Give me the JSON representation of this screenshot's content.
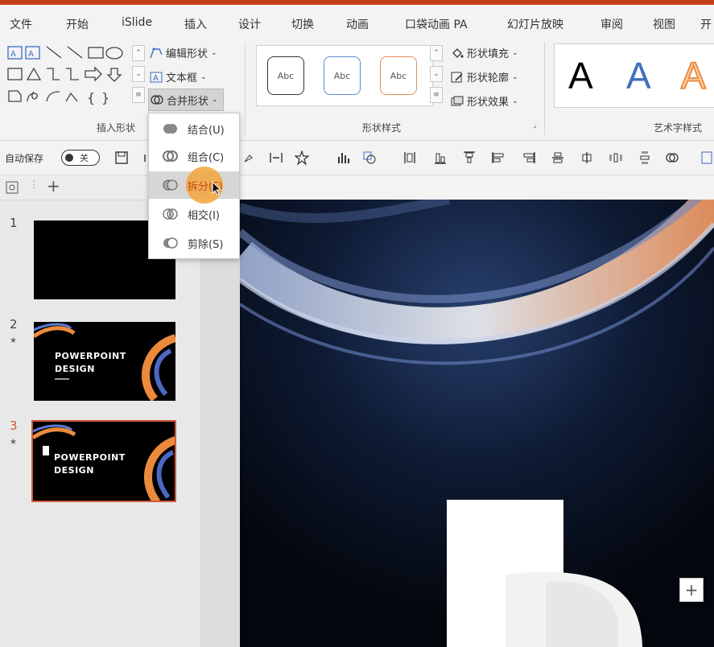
{
  "menu": {
    "tabs": [
      "文件",
      "开始",
      "iSlide",
      "插入",
      "设计",
      "切换",
      "动画",
      "口袋动画 PA",
      "幻灯片放映",
      "审阅",
      "视图",
      "开"
    ]
  },
  "ribbon": {
    "insert_shapes": {
      "label": "插入形状",
      "edit_shape": "编辑形状",
      "text_box": "文本框",
      "merge_shapes": "合并形状"
    },
    "shape_styles": {
      "label": "形状样式",
      "preset_text": "Abc",
      "fill": "形状填充",
      "outline": "形状轮廓",
      "effects": "形状效果"
    },
    "wordart": {
      "label": "艺术字样式",
      "letter": "A"
    }
  },
  "qat": {
    "autosave_label": "自动保存",
    "autosave_toggle": "关"
  },
  "merge_menu": {
    "items": [
      "结合(U)",
      "组合(C)",
      "拆分(F)",
      "相交(I)",
      "剪除(S)"
    ],
    "highlighted_index": 2
  },
  "slides": [
    {
      "number": "1",
      "star": "",
      "title1": "",
      "title2": ""
    },
    {
      "number": "2",
      "star": "★",
      "title1": "POWERPOINT",
      "title2": "DESIGN"
    },
    {
      "number": "3",
      "star": "★",
      "title1": "POWERPOINT",
      "title2": "DESIGN"
    }
  ],
  "canvas": {
    "plus_button": "+"
  },
  "colors": {
    "accent": "#c43e1c",
    "selected_slide": "#d2593a",
    "highlight": "#f4a53c"
  }
}
